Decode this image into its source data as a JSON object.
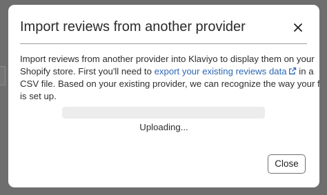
{
  "modal": {
    "title": "Import reviews from another provider",
    "description": {
      "line1": "Import reviews from another provider into Klaviyo to display them on your",
      "line2_before_link": "Shopify store. First you'll need to ",
      "link_text": "export your existing reviews data",
      "line2_after_link": " in a",
      "line3": "CSV file. Based on your existing provider, we can recognize the way your file",
      "line4": "is set up."
    },
    "upload": {
      "progress_fraction": 0,
      "status_text": "Uploading..."
    },
    "footer": {
      "close_label": "Close"
    },
    "icons": {
      "close": "close-icon",
      "external_link": "external-link-icon"
    }
  },
  "colors": {
    "overlay": "#6e6e6e",
    "dialog": "#ffffff",
    "link": "#2b67b3",
    "progress_track": "#ececec",
    "button_border": "#6f6f6f"
  }
}
